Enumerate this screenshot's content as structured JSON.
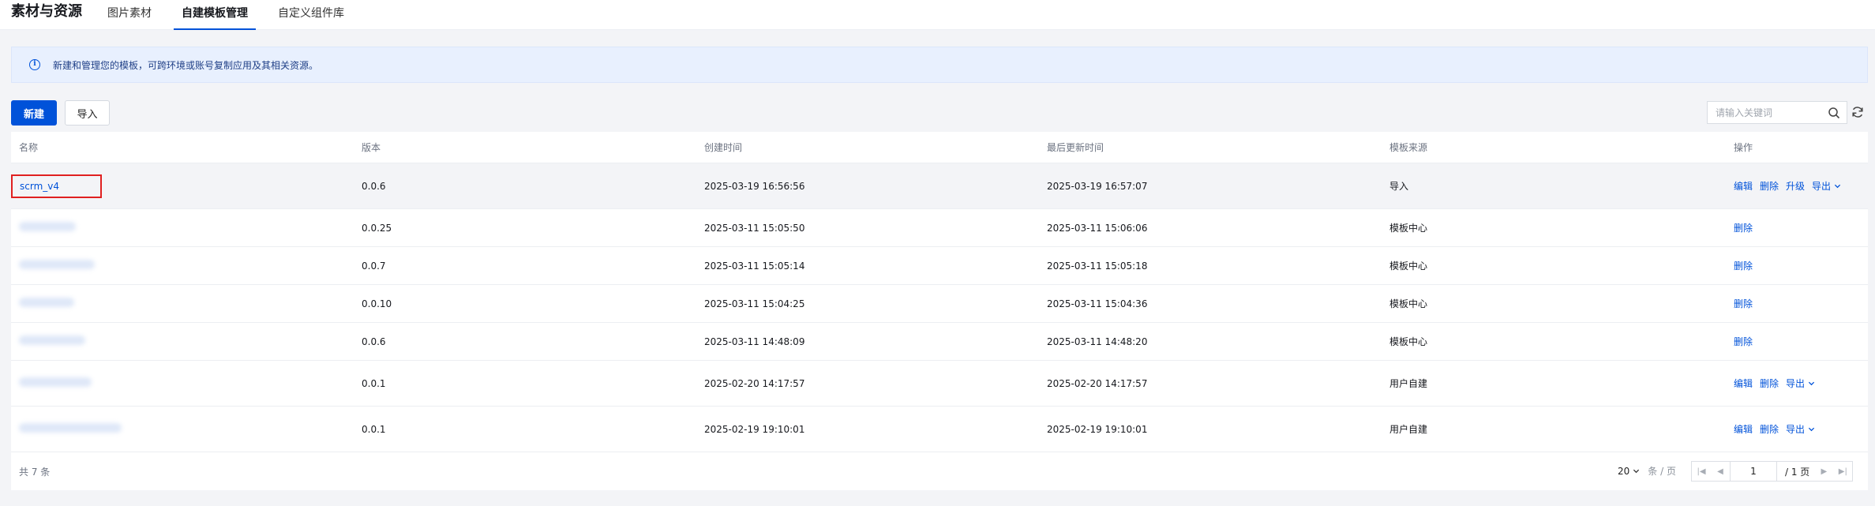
{
  "header": {
    "title": "素材与资源",
    "tabs": [
      {
        "label": "图片素材",
        "active": false
      },
      {
        "label": "自建模板管理",
        "active": true
      },
      {
        "label": "自定义组件库",
        "active": false
      }
    ]
  },
  "notice": {
    "text": "新建和管理您的模板，可跨环境或账号复制应用及其相关资源。",
    "icon": "info-icon"
  },
  "toolbar": {
    "new_label": "新建",
    "import_label": "导入",
    "search_placeholder": "请输入关键词"
  },
  "table": {
    "columns": [
      "名称",
      "版本",
      "创建时间",
      "最后更新时间",
      "模板来源",
      "操作"
    ],
    "rows": [
      {
        "name": "scrm_v4",
        "version": "0.0.6",
        "created": "2025-03-19 16:56:56",
        "updated": "2025-03-19 16:57:07",
        "source": "导入",
        "ops": [
          "编辑",
          "删除",
          "升级",
          "导出"
        ]
      },
      {
        "name": "",
        "version": "0.0.25",
        "created": "2025-03-11 15:05:50",
        "updated": "2025-03-11 15:06:06",
        "source": "模板中心",
        "ops": [
          "删除"
        ]
      },
      {
        "name": "",
        "version": "0.0.7",
        "created": "2025-03-11 15:05:14",
        "updated": "2025-03-11 15:05:18",
        "source": "模板中心",
        "ops": [
          "删除"
        ]
      },
      {
        "name": "",
        "version": "0.0.10",
        "created": "2025-03-11 15:04:25",
        "updated": "2025-03-11 15:04:36",
        "source": "模板中心",
        "ops": [
          "删除"
        ]
      },
      {
        "name": "",
        "version": "0.0.6",
        "created": "2025-03-11 14:48:09",
        "updated": "2025-03-11 14:48:20",
        "source": "模板中心",
        "ops": [
          "删除"
        ]
      },
      {
        "name": "",
        "version": "0.0.1",
        "created": "2025-02-20 14:17:57",
        "updated": "2025-02-20 14:17:57",
        "source": "用户自建",
        "ops": [
          "编辑",
          "删除",
          "导出"
        ]
      },
      {
        "name": "",
        "version": "0.0.1",
        "created": "2025-02-19 19:10:01",
        "updated": "2025-02-19 19:10:01",
        "source": "用户自建",
        "ops": [
          "编辑",
          "删除",
          "导出"
        ]
      }
    ]
  },
  "footer": {
    "total": "共 7 条",
    "page_size": "20",
    "page_size_unit": "条 / 页",
    "current_page": "1",
    "total_pages": "/ 1 页"
  },
  "colors": {
    "primary": "#0052d9",
    "highlight_border": "#e02020"
  }
}
